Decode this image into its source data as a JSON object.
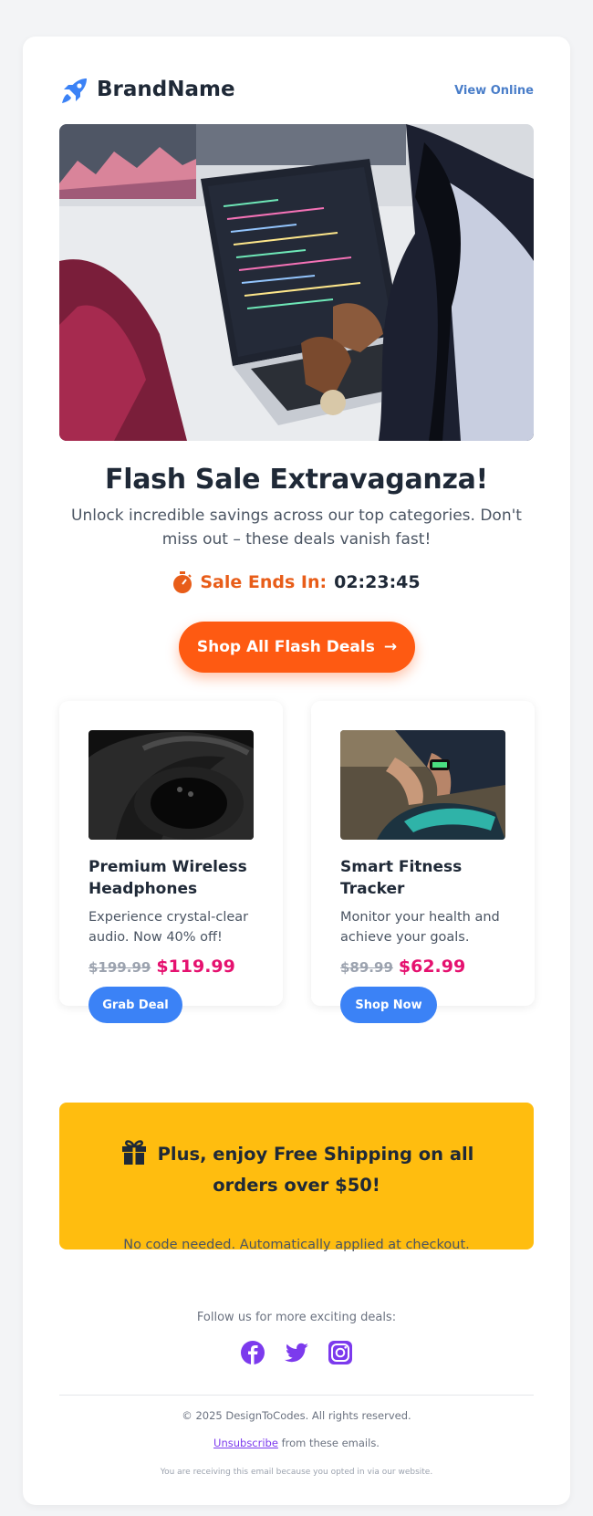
{
  "header": {
    "brand": "BrandName",
    "view_online": "View Online"
  },
  "hero": {
    "headline": "Flash Sale Extravaganza!",
    "subhead": "Unlock incredible savings across our top categories. Don't miss out – these deals vanish fast!"
  },
  "timer": {
    "label": "Sale Ends In:",
    "value": "02:23:45"
  },
  "cta": {
    "label": "Shop All Flash Deals",
    "arrow": "→"
  },
  "products": [
    {
      "name": "Premium Wireless Headphones",
      "desc": "Experience crystal-clear audio. Now 40% off!",
      "old_price": "$199.99",
      "new_price": "$119.99",
      "button": "Grab Deal"
    },
    {
      "name": "Smart Fitness Tracker",
      "desc": "Monitor your health and achieve your goals.",
      "old_price": "$89.99",
      "new_price": "$62.99",
      "button": "Shop Now"
    }
  ],
  "shipping": {
    "title": "Plus, enjoy Free Shipping on all orders over $50!",
    "sub": "No code needed. Automatically applied at checkout."
  },
  "footer": {
    "follow": "Follow us for more exciting deals:",
    "copyright": "© 2025 DesignToCodes. All rights reserved.",
    "unsubscribe": "Unsubscribe",
    "unsubscribe_suffix": " from these emails.",
    "fine_print": "You are receiving this email because you opted in via our website."
  },
  "colors": {
    "accent_orange": "#fe5a12",
    "price_pink": "#e5116f",
    "button_blue": "#3b82f6",
    "banner_yellow": "#ffbd0f",
    "social_purple": "#7c3aed"
  },
  "icons": [
    "rocket-icon",
    "stopwatch-icon",
    "gift-icon",
    "facebook-icon",
    "twitter-icon",
    "instagram-icon"
  ]
}
